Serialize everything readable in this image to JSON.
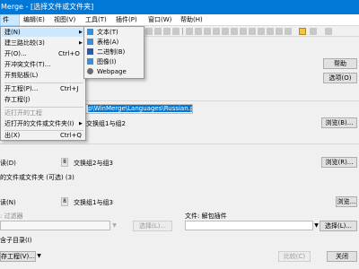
{
  "window": {
    "title": "Merge - [选择文件或文件夹]"
  },
  "menubar": [
    "件",
    "编辑(E)",
    "视图(V)",
    "工具(T)",
    "插件(P)",
    "窗口(W)",
    "帮助(H)"
  ],
  "file_menu": {
    "items": [
      {
        "label": "建(N)",
        "shortcut": "",
        "submenu": true,
        "highlight": true
      },
      {
        "label": "建三路比较(3)",
        "shortcut": "",
        "submenu": true
      },
      {
        "label": "开(O)...",
        "shortcut": "Ctrl+O"
      },
      {
        "label": "开冲突文件(T)...",
        "shortcut": ""
      },
      {
        "label": "开剪贴板(L)",
        "shortcut": ""
      },
      {
        "label": "开工程(P)...",
        "shortcut": "Ctrl+J"
      },
      {
        "label": "存工程(J)",
        "shortcut": ""
      },
      {
        "label": "近打开的工程",
        "shortcut": "",
        "disabled": true
      },
      {
        "label": "近打开的文件或文件夹(I)",
        "shortcut": "",
        "submenu": true
      },
      {
        "label": "出(X)",
        "shortcut": "Ctrl+Q"
      }
    ]
  },
  "new_submenu": {
    "items": [
      {
        "label": "文本(T)",
        "icon": "text-icon"
      },
      {
        "label": "表格(A)",
        "icon": "table-icon"
      },
      {
        "label": "二进制(B)",
        "icon": "binary-icon"
      },
      {
        "label": "图像(I)",
        "icon": "image-icon"
      },
      {
        "label": "Webpage",
        "icon": "webpage-icon"
      }
    ]
  },
  "form": {
    "help_button": "帮助",
    "options_button": "选项(O)",
    "path_value": "p\\WinMerge\\Languages\\Russian.po",
    "swap12": "交换组1与组2",
    "browse": "浏览(B)...",
    "section_d": "读(D)",
    "swap23": "交换组2与组3",
    "browse2": "浏览(R)...",
    "folder_options": "的文件或文件夹 (可选) (3)",
    "section_n": "读(N)",
    "swap13": "交换组1与组3",
    "browse3": "浏览...",
    "filter_label": ": 过滤器",
    "select_button": "选择(L)...",
    "unpacker_label": "文件: 解包插件",
    "select_button2": "选择(L)...",
    "subfolders": "含子目录(I)",
    "save_project": "存工程(V)...",
    "compare": "比较(C)",
    "close": "关闭",
    "compare2": "比较(C)",
    "close2": "关闭",
    "num8a": "8",
    "num8b": "8",
    "num8c": "8"
  },
  "colors": {
    "titlebar": "#0078d7",
    "selection": "#0078d7",
    "menu_highlight": "#cce8ff"
  }
}
